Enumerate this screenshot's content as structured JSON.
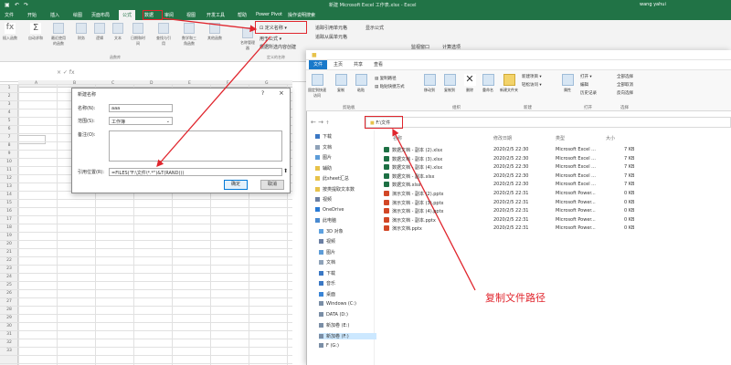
{
  "excel": {
    "title": "新建 Microsoft Excel 工作表.xlsx - Excel",
    "user": "wang yahui",
    "tabs": [
      "文件",
      "开始",
      "插入",
      "绘图",
      "页面布局",
      "公式",
      "数据",
      "审阅",
      "视图",
      "开发工具",
      "帮助",
      "Power Pivot",
      "操作说明搜索"
    ],
    "active_tab": "公式",
    "ribbon_buttons": [
      "插入函数",
      "自动求和",
      "最近使用的函数",
      "财务",
      "逻辑",
      "文本",
      "日期和时间",
      "查找与引用",
      "数学和三角函数",
      "其他函数"
    ],
    "group_function_library": "函数库",
    "name_manager": "名称管理器",
    "define_name": "定义名称",
    "use_in_formula": "用于公式",
    "create_from_selection": "根据所选内容创建",
    "group_defined_names": "定义的名称",
    "trace_precedents": "追踪引用单元格",
    "trace_dependents": "追踪从属单元格",
    "show_formulas": "显示公式",
    "watch_window": "监视窗口",
    "calc_options": "计算选项",
    "namebox": "A1",
    "columns": [
      "A",
      "B",
      "C",
      "D",
      "E",
      "F",
      "G"
    ],
    "rows": [
      "1",
      "2",
      "3",
      "4",
      "5",
      "6",
      "7",
      "8",
      "9",
      "10",
      "11",
      "12",
      "13",
      "14",
      "15",
      "16",
      "17",
      "18",
      "19",
      "20",
      "21",
      "22",
      "23",
      "24",
      "25",
      "26",
      "27",
      "28",
      "29",
      "30",
      "31",
      "32",
      "33"
    ]
  },
  "dialog": {
    "title": "新建名称",
    "name_label": "名称(N):",
    "name_value": "aaa",
    "scope_label": "范围(S):",
    "scope_value": "工作簿",
    "comment_label": "备注(O):",
    "ref_label": "引用位置(R):",
    "ref_value": "=FILES(\"F:\\文件\\*.*\")&T(RAND())",
    "ok": "确定",
    "cancel": "取消"
  },
  "explorer": {
    "tabs": [
      "文件",
      "主页",
      "共享",
      "查看"
    ],
    "ribbon": {
      "pin": "固定到快速访问",
      "copy": "复制",
      "paste": "粘贴",
      "copy_path": "复制路径",
      "paste_shortcut": "粘贴快捷方式",
      "move_to": "移动到",
      "copy_to": "复制到",
      "delete": "删除",
      "rename": "重命名",
      "new_folder": "新建文件夹",
      "new_item": "新建项目",
      "easy_access": "轻松访问",
      "properties": "属性",
      "open": "打开",
      "edit": "编辑",
      "history": "历史记录",
      "select_all": "全部选择",
      "select_none": "全部取消",
      "invert": "反向选择",
      "groups": [
        "剪贴板",
        "组织",
        "新建",
        "打开",
        "选择"
      ]
    },
    "address": "F:\\文件",
    "headers": {
      "name": "名称",
      "date": "修改日期",
      "type": "类型",
      "size": "大小"
    },
    "nav": [
      {
        "label": "下载",
        "color": "#3b78c4"
      },
      {
        "label": "文档",
        "color": "#8fa2b8"
      },
      {
        "label": "图片",
        "color": "#5d9cd8"
      },
      {
        "label": "辅助",
        "color": "#e7c24a"
      },
      {
        "label": "此sheet汇总",
        "color": "#e7c24a"
      },
      {
        "label": "按类提取文本数",
        "color": "#e7c24a"
      },
      {
        "label": "视频",
        "color": "#6b7fa3"
      },
      {
        "label": "OneDrive",
        "color": "#2a7bd5"
      },
      {
        "label": "此电脑",
        "color": "#4a8ad0"
      },
      {
        "label": "3D 对象",
        "color": "#5da1e0"
      },
      {
        "label": "视频",
        "color": "#6b7fa3"
      },
      {
        "label": "图片",
        "color": "#5d9cd8"
      },
      {
        "label": "文档",
        "color": "#8fa2b8"
      },
      {
        "label": "下载",
        "color": "#3b78c4"
      },
      {
        "label": "音乐",
        "color": "#3b78c4"
      },
      {
        "label": "桌面",
        "color": "#3a85d6"
      },
      {
        "label": "Windows (C:)",
        "color": "#7a8ea6"
      },
      {
        "label": "DATA (D:)",
        "color": "#7a8ea6"
      },
      {
        "label": "新加卷 (E:)",
        "color": "#7a8ea6"
      },
      {
        "label": "新加卷 (F:)",
        "color": "#7a8ea6"
      },
      {
        "label": "F (G:)",
        "color": "#7a8ea6"
      }
    ],
    "files": [
      {
        "name": "数据文档 - 副本 (2).xlsx",
        "date": "2020/2/5 22:30",
        "type": "Microsoft Excel ...",
        "size": "7 KB",
        "icon": "xlsx"
      },
      {
        "name": "数据文档 - 副本 (3).xlsx",
        "date": "2020/2/5 22:30",
        "type": "Microsoft Excel ...",
        "size": "7 KB",
        "icon": "xlsx"
      },
      {
        "name": "数据文档 - 副本 (4).xlsx",
        "date": "2020/2/5 22:30",
        "type": "Microsoft Excel ...",
        "size": "7 KB",
        "icon": "xlsx"
      },
      {
        "name": "数据文档 - 副本.xlsx",
        "date": "2020/2/5 22:30",
        "type": "Microsoft Excel ...",
        "size": "7 KB",
        "icon": "xlsx"
      },
      {
        "name": "数据文档.xlsx",
        "date": "2020/2/5 22:30",
        "type": "Microsoft Excel ...",
        "size": "7 KB",
        "icon": "xlsx"
      },
      {
        "name": "演示文档 - 副本 (2).pptx",
        "date": "2020/2/5 22:31",
        "type": "Microsoft Power...",
        "size": "0 KB",
        "icon": "pptx"
      },
      {
        "name": "演示文档 - 副本 (3).pptx",
        "date": "2020/2/5 22:31",
        "type": "Microsoft Power...",
        "size": "0 KB",
        "icon": "pptx"
      },
      {
        "name": "演示文档 - 副本 (4).pptx",
        "date": "2020/2/5 22:31",
        "type": "Microsoft Power...",
        "size": "0 KB",
        "icon": "pptx"
      },
      {
        "name": "演示文档 - 副本.pptx",
        "date": "2020/2/5 22:31",
        "type": "Microsoft Power...",
        "size": "0 KB",
        "icon": "pptx"
      },
      {
        "name": "演示文档.pptx",
        "date": "2020/2/5 22:31",
        "type": "Microsoft Power...",
        "size": "0 KB",
        "icon": "pptx"
      }
    ]
  },
  "annotation": "复制文件路径",
  "colors": {
    "excel_green": "#217346",
    "annotation_red": "#e0252d",
    "explorer_blue": "#1979ca",
    "xlsx_icon": "#1d7044",
    "pptx_icon": "#d24726"
  }
}
